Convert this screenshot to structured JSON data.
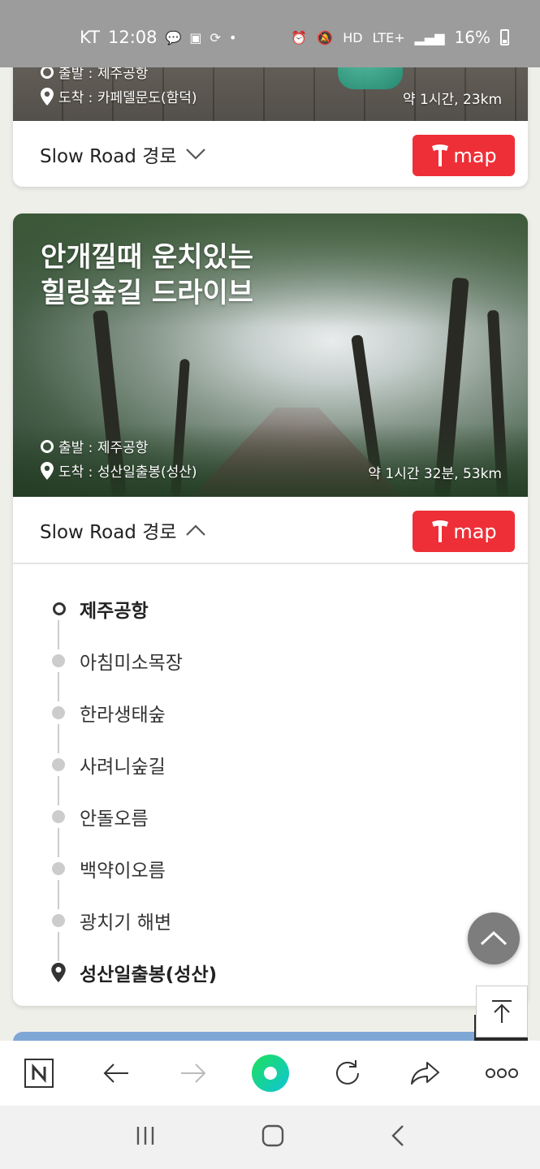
{
  "status": {
    "carrier": "KT",
    "time": "12:08",
    "battery": "16%",
    "network": "LTE+"
  },
  "card1": {
    "start": "출발 : 제주공항",
    "arrive": "도착 : 카페델문도(함덕)",
    "distance": "약 1시간, 23km",
    "slow_road": "Slow Road 경로",
    "map_label": "map"
  },
  "card2": {
    "title_line1": "안개낄때 운치있는",
    "title_line2": "힐링숲길 드라이브",
    "start": "출발 : 제주공항",
    "arrive": "도착 : 성산일출봉(성산)",
    "distance": "약 1시간 32분, 53km",
    "slow_road": "Slow Road 경로",
    "map_label": "map",
    "stops": [
      "제주공항",
      "아침미소목장",
      "한라생태숲",
      "사려니숲길",
      "안돌오름",
      "백약이오름",
      "광치기 해변",
      "성산일출봉(성산)"
    ]
  },
  "colors": {
    "map_red": "#ee2f37",
    "status_gray": "#9c9c9c"
  },
  "icons": {
    "browser_bar": [
      "naver-home-icon",
      "back-icon",
      "forward-icon",
      "green-dot-icon",
      "refresh-icon",
      "share-icon",
      "more-icon"
    ],
    "nav_bar": [
      "recent-apps-icon",
      "home-icon",
      "back-nav-icon"
    ]
  }
}
